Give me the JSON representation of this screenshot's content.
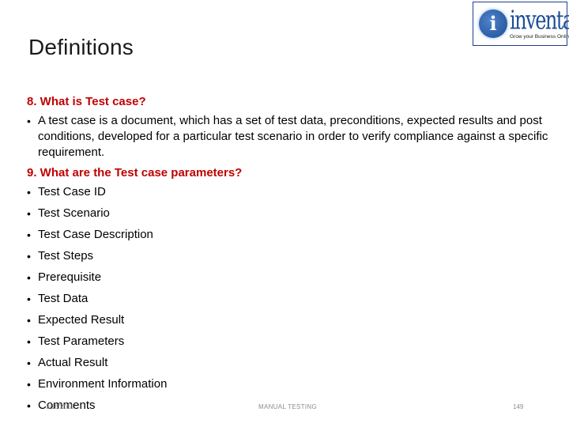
{
  "slide": {
    "title": "Definitions",
    "logo": {
      "icon": "inventateq-logo-icon",
      "glyph": "i",
      "name": "inventateq",
      "tagline": "Grow your Business Online"
    },
    "sections": [
      {
        "question": "8. What is Test case?",
        "answer": "A test case is a document, which has a set of test data, preconditions, expected results and post conditions, developed for a particular test scenario in order to verify compliance against a specific requirement."
      },
      {
        "question": "9. What are the Test case parameters?",
        "items": [
          "Test Case ID",
          "Test Scenario",
          "Test Case Description",
          "Test Steps",
          "Prerequisite",
          "Test Data",
          "Expected Result",
          "Test Parameters",
          "Actual Result",
          "Environment Information",
          "Comments"
        ]
      }
    ],
    "bullet_glyph": "•",
    "footer": {
      "date": "3/16/2018",
      "center": "MANUAL TESTING",
      "page": "149"
    }
  }
}
